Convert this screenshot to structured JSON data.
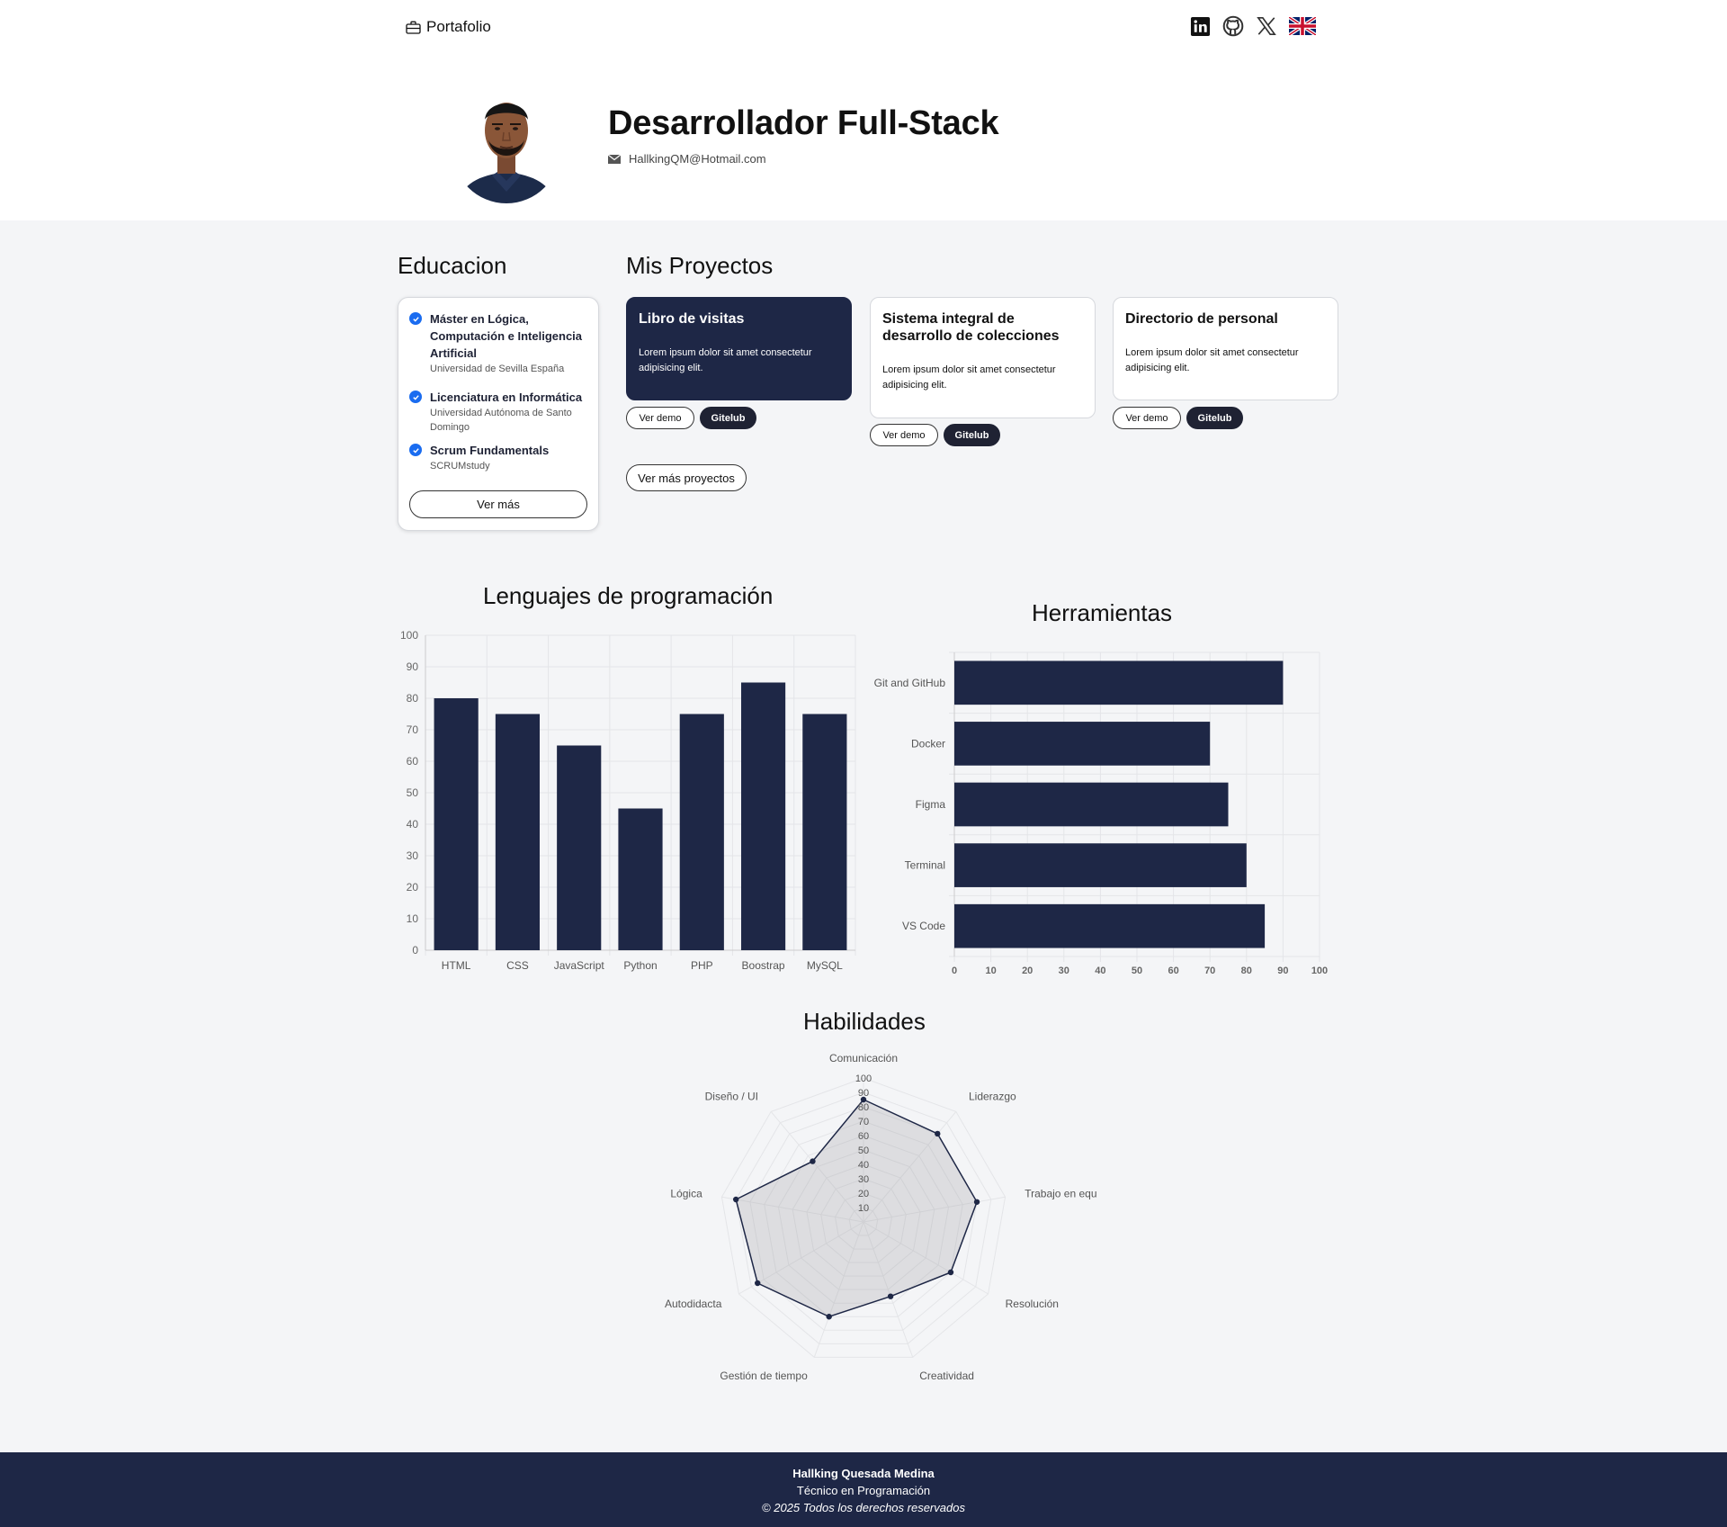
{
  "header": {
    "brand": "Portafolio",
    "social": [
      "linkedin-icon",
      "github-icon",
      "x-icon",
      "uk-flag-icon"
    ]
  },
  "hero": {
    "title": "Desarrollador Full-Stack",
    "email": "HallkingQM@Hotmail.com"
  },
  "education": {
    "heading": "Educacion",
    "items": [
      {
        "title": "Máster en Lógica, Computación e Inteligencia Artificial",
        "institution": "Universidad de Sevilla España"
      },
      {
        "title": "Licenciatura en Informática",
        "institution": "Universidad Autónoma de Santo Domingo"
      },
      {
        "title": "Scrum Fundamentals",
        "institution": "SCRUMstudy"
      }
    ],
    "more_label": "Ver más"
  },
  "projects": {
    "heading": "Mis Proyectos",
    "items": [
      {
        "title": "Libro de visitas",
        "desc": "Lorem ipsum dolor sit amet consectetur adipisicing elit.",
        "demo_label": "Ver demo",
        "repo_label": "Gitelub"
      },
      {
        "title": "Sistema integral de desarrollo de colecciones",
        "desc": "Lorem ipsum dolor sit amet consectetur adipisicing elit.",
        "demo_label": "Ver demo",
        "repo_label": "Gitelub"
      },
      {
        "title": "Directorio de personal",
        "desc": "Lorem ipsum dolor sit amet consectetur adipisicing elit.",
        "demo_label": "Ver demo",
        "repo_label": "Gitelub"
      }
    ],
    "more_label": "Ver más proyectos"
  },
  "colors": {
    "navy": "#1e2746",
    "accent": "#1a6cf0",
    "grid": "#e4e5e8"
  },
  "chart_data": [
    {
      "type": "bar",
      "title": "Lenguajes de programación",
      "categories": [
        "HTML",
        "CSS",
        "JavaScript",
        "Python",
        "PHP",
        "Boostrap",
        "MySQL"
      ],
      "values": [
        80,
        75,
        65,
        45,
        75,
        85,
        75
      ],
      "ylim": [
        0,
        100
      ],
      "yticks": [
        0,
        10,
        20,
        30,
        40,
        50,
        60,
        70,
        80,
        90,
        100
      ],
      "grid": true
    },
    {
      "type": "bar",
      "orientation": "horizontal",
      "title": "Herramientas",
      "categories": [
        "Git and GitHub",
        "Docker",
        "Figma",
        "Terminal",
        "VS Code"
      ],
      "values": [
        90,
        70,
        75,
        80,
        85
      ],
      "xlim": [
        0,
        100
      ],
      "xticks": [
        0,
        10,
        20,
        30,
        40,
        50,
        60,
        70,
        80,
        90,
        100
      ],
      "grid": true
    },
    {
      "type": "radar",
      "title": "Habilidades",
      "categories": [
        "Comunicación",
        "Liderazgo",
        "Trabajo en equipo",
        "Resolución",
        "Creatividad",
        "Gestión de tiempo",
        "Autodidacta",
        "Lógica",
        "Diseño / UI"
      ],
      "values": [
        85,
        80,
        80,
        70,
        55,
        70,
        85,
        90,
        55
      ],
      "rlim": [
        0,
        100
      ],
      "rticks": [
        10,
        20,
        30,
        40,
        50,
        60,
        70,
        80,
        90,
        100
      ]
    }
  ],
  "footer": {
    "name": "Hallking Quesada Medina",
    "role": "Técnico en Programación",
    "copyright": "© 2025 Todos los derechos reservados"
  }
}
